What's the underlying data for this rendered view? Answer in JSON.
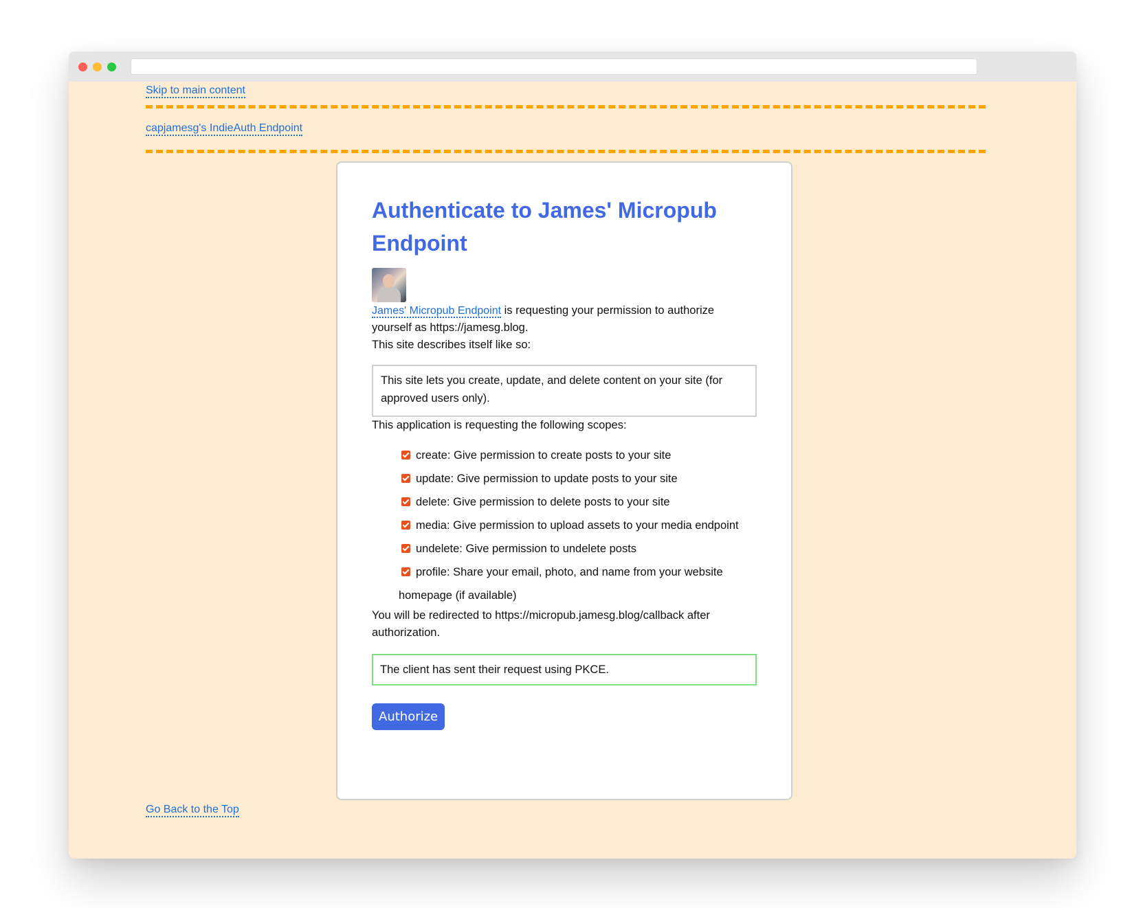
{
  "links": {
    "skip": "Skip to main content",
    "site_title": "capjamesg's IndieAuth Endpoint",
    "back_to_top": "Go Back to the Top"
  },
  "card": {
    "heading": "Authenticate to James' Micropub Endpoint",
    "client_link": "James' Micropub Endpoint",
    "request_text": "is requesting your permission to authorize yourself as https://jamesg.blog.",
    "describes_label": "This site describes itself like so:",
    "description": "This site lets you create, update, and delete content on your site (for approved users only).",
    "scopes_label": "This application is requesting the following scopes:",
    "scopes": [
      {
        "label": "create: Give permission to create posts to your site",
        "checked": true
      },
      {
        "label": "update: Give permission to update posts to your site",
        "checked": true
      },
      {
        "label": "delete: Give permission to delete posts to your site",
        "checked": true
      },
      {
        "label": "media: Give permission to upload assets to your media endpoint",
        "checked": true
      },
      {
        "label": "undelete: Give permission to undelete posts",
        "checked": true
      },
      {
        "label": "profile: Share your email, photo, and name from your website homepage (if available)",
        "checked": true
      }
    ],
    "redirect_text": "You will be redirected to https://micropub.jamesg.blog/callback after authorization.",
    "pkce_text": "The client has sent their request using PKCE.",
    "authorize_label": "Authorize"
  },
  "colors": {
    "page_background": "#feecd2",
    "heading": "#4169e1",
    "link": "#1e6fd6",
    "dashed_rule": "#ffa500",
    "checkbox": "#e8501e",
    "pkce_border": "#7ee07e",
    "button": "#4169e1"
  }
}
